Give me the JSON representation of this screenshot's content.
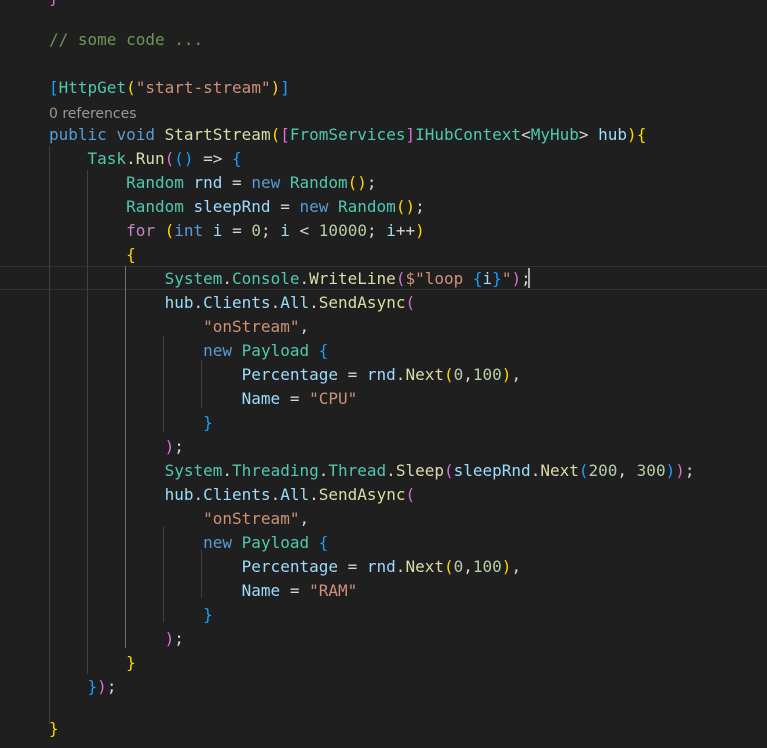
{
  "editor": {
    "codelens": "0 references",
    "lines": [
      [
        {
          "t": "}",
          "c": "b2"
        }
      ],
      [],
      [
        {
          "t": "// some code ...",
          "c": "cm"
        }
      ],
      [],
      [
        {
          "t": "[",
          "c": "b3"
        },
        {
          "t": "HttpGet",
          "c": "ty"
        },
        {
          "t": "(",
          "c": "b1"
        },
        {
          "t": "\"start-stream\"",
          "c": "st"
        },
        {
          "t": ")",
          "c": "b1"
        },
        {
          "t": "]",
          "c": "b3"
        }
      ],
      [
        {
          "t": "public",
          "c": "kw"
        },
        {
          "t": " ",
          "c": "tc"
        },
        {
          "t": "void",
          "c": "kw"
        },
        {
          "t": " ",
          "c": "tc"
        },
        {
          "t": "StartStream",
          "c": "fn"
        },
        {
          "t": "(",
          "c": "b1"
        },
        {
          "t": "[",
          "c": "b2"
        },
        {
          "t": "FromServices",
          "c": "ty"
        },
        {
          "t": "]",
          "c": "b2"
        },
        {
          "t": "IHubContext",
          "c": "ty"
        },
        {
          "t": "<",
          "c": "tc"
        },
        {
          "t": "MyHub",
          "c": "ty"
        },
        {
          "t": "> ",
          "c": "tc"
        },
        {
          "t": "hub",
          "c": "vr"
        },
        {
          "t": ")",
          "c": "b1"
        },
        {
          "t": "{",
          "c": "b1"
        }
      ],
      [
        {
          "t": "    ",
          "c": "tc"
        },
        {
          "t": "Task",
          "c": "ty"
        },
        {
          "t": ".",
          "c": "tc"
        },
        {
          "t": "Run",
          "c": "fn"
        },
        {
          "t": "(",
          "c": "b2"
        },
        {
          "t": "()",
          "c": "b3"
        },
        {
          "t": " => ",
          "c": "tc"
        },
        {
          "t": "{",
          "c": "b3"
        }
      ],
      [
        {
          "t": "        ",
          "c": "tc"
        },
        {
          "t": "Random",
          "c": "ty"
        },
        {
          "t": " ",
          "c": "tc"
        },
        {
          "t": "rnd",
          "c": "vr"
        },
        {
          "t": " = ",
          "c": "tc"
        },
        {
          "t": "new",
          "c": "kw"
        },
        {
          "t": " ",
          "c": "tc"
        },
        {
          "t": "Random",
          "c": "ty"
        },
        {
          "t": "()",
          "c": "b1"
        },
        {
          "t": ";",
          "c": "tc"
        }
      ],
      [
        {
          "t": "        ",
          "c": "tc"
        },
        {
          "t": "Random",
          "c": "ty"
        },
        {
          "t": " ",
          "c": "tc"
        },
        {
          "t": "sleepRnd",
          "c": "vr"
        },
        {
          "t": " = ",
          "c": "tc"
        },
        {
          "t": "new",
          "c": "kw"
        },
        {
          "t": " ",
          "c": "tc"
        },
        {
          "t": "Random",
          "c": "ty"
        },
        {
          "t": "()",
          "c": "b1"
        },
        {
          "t": ";",
          "c": "tc"
        }
      ],
      [
        {
          "t": "        ",
          "c": "tc"
        },
        {
          "t": "for",
          "c": "ctl"
        },
        {
          "t": " ",
          "c": "tc"
        },
        {
          "t": "(",
          "c": "b1"
        },
        {
          "t": "int",
          "c": "kw"
        },
        {
          "t": " ",
          "c": "tc"
        },
        {
          "t": "i",
          "c": "vr"
        },
        {
          "t": " = ",
          "c": "tc"
        },
        {
          "t": "0",
          "c": "nm"
        },
        {
          "t": "; ",
          "c": "tc"
        },
        {
          "t": "i",
          "c": "vr"
        },
        {
          "t": " < ",
          "c": "tc"
        },
        {
          "t": "10000",
          "c": "nm"
        },
        {
          "t": "; ",
          "c": "tc"
        },
        {
          "t": "i",
          "c": "vr"
        },
        {
          "t": "++",
          "c": "tc"
        },
        {
          "t": ")",
          "c": "b1"
        }
      ],
      [
        {
          "t": "        ",
          "c": "tc"
        },
        {
          "t": "{",
          "c": "b1"
        }
      ],
      [
        {
          "t": "            ",
          "c": "tc"
        },
        {
          "t": "System",
          "c": "ty"
        },
        {
          "t": ".",
          "c": "tc"
        },
        {
          "t": "Console",
          "c": "ty"
        },
        {
          "t": ".",
          "c": "tc"
        },
        {
          "t": "WriteLine",
          "c": "fn"
        },
        {
          "t": "(",
          "c": "b2"
        },
        {
          "t": "$\"loop ",
          "c": "st"
        },
        {
          "t": "{",
          "c": "b3"
        },
        {
          "t": "i",
          "c": "vr"
        },
        {
          "t": "}",
          "c": "b3"
        },
        {
          "t": "\"",
          "c": "st"
        },
        {
          "t": ")",
          "c": "b2"
        },
        {
          "t": ";",
          "c": "tc"
        }
      ],
      [
        {
          "t": "            ",
          "c": "tc"
        },
        {
          "t": "hub",
          "c": "vr"
        },
        {
          "t": ".",
          "c": "tc"
        },
        {
          "t": "Clients",
          "c": "vr"
        },
        {
          "t": ".",
          "c": "tc"
        },
        {
          "t": "All",
          "c": "vr"
        },
        {
          "t": ".",
          "c": "tc"
        },
        {
          "t": "SendAsync",
          "c": "fn"
        },
        {
          "t": "(",
          "c": "b2"
        }
      ],
      [
        {
          "t": "                ",
          "c": "tc"
        },
        {
          "t": "\"onStream\"",
          "c": "st"
        },
        {
          "t": ",",
          "c": "tc"
        }
      ],
      [
        {
          "t": "                ",
          "c": "tc"
        },
        {
          "t": "new",
          "c": "kw"
        },
        {
          "t": " ",
          "c": "tc"
        },
        {
          "t": "Payload",
          "c": "ty"
        },
        {
          "t": " ",
          "c": "tc"
        },
        {
          "t": "{",
          "c": "b3"
        }
      ],
      [
        {
          "t": "                    ",
          "c": "tc"
        },
        {
          "t": "Percentage",
          "c": "vr"
        },
        {
          "t": " = ",
          "c": "tc"
        },
        {
          "t": "rnd",
          "c": "vr"
        },
        {
          "t": ".",
          "c": "tc"
        },
        {
          "t": "Next",
          "c": "fn"
        },
        {
          "t": "(",
          "c": "b1"
        },
        {
          "t": "0",
          "c": "nm"
        },
        {
          "t": ",",
          "c": "tc"
        },
        {
          "t": "100",
          "c": "nm"
        },
        {
          "t": ")",
          "c": "b1"
        },
        {
          "t": ",",
          "c": "tc"
        }
      ],
      [
        {
          "t": "                    ",
          "c": "tc"
        },
        {
          "t": "Name",
          "c": "vr"
        },
        {
          "t": " = ",
          "c": "tc"
        },
        {
          "t": "\"CPU\"",
          "c": "st"
        }
      ],
      [
        {
          "t": "                ",
          "c": "tc"
        },
        {
          "t": "}",
          "c": "b3"
        }
      ],
      [
        {
          "t": "            ",
          "c": "tc"
        },
        {
          "t": ")",
          "c": "b2"
        },
        {
          "t": ";",
          "c": "tc"
        }
      ],
      [
        {
          "t": "            ",
          "c": "tc"
        },
        {
          "t": "System",
          "c": "ty"
        },
        {
          "t": ".",
          "c": "tc"
        },
        {
          "t": "Threading",
          "c": "ty"
        },
        {
          "t": ".",
          "c": "tc"
        },
        {
          "t": "Thread",
          "c": "ty"
        },
        {
          "t": ".",
          "c": "tc"
        },
        {
          "t": "Sleep",
          "c": "fn"
        },
        {
          "t": "(",
          "c": "b2"
        },
        {
          "t": "sleepRnd",
          "c": "vr"
        },
        {
          "t": ".",
          "c": "tc"
        },
        {
          "t": "Next",
          "c": "fn"
        },
        {
          "t": "(",
          "c": "b3"
        },
        {
          "t": "200",
          "c": "nm"
        },
        {
          "t": ", ",
          "c": "tc"
        },
        {
          "t": "300",
          "c": "nm"
        },
        {
          "t": ")",
          "c": "b3"
        },
        {
          "t": ")",
          "c": "b2"
        },
        {
          "t": ";",
          "c": "tc"
        }
      ],
      [
        {
          "t": "            ",
          "c": "tc"
        },
        {
          "t": "hub",
          "c": "vr"
        },
        {
          "t": ".",
          "c": "tc"
        },
        {
          "t": "Clients",
          "c": "vr"
        },
        {
          "t": ".",
          "c": "tc"
        },
        {
          "t": "All",
          "c": "vr"
        },
        {
          "t": ".",
          "c": "tc"
        },
        {
          "t": "SendAsync",
          "c": "fn"
        },
        {
          "t": "(",
          "c": "b2"
        }
      ],
      [
        {
          "t": "                ",
          "c": "tc"
        },
        {
          "t": "\"onStream\"",
          "c": "st"
        },
        {
          "t": ",",
          "c": "tc"
        }
      ],
      [
        {
          "t": "                ",
          "c": "tc"
        },
        {
          "t": "new",
          "c": "kw"
        },
        {
          "t": " ",
          "c": "tc"
        },
        {
          "t": "Payload",
          "c": "ty"
        },
        {
          "t": " ",
          "c": "tc"
        },
        {
          "t": "{",
          "c": "b3"
        }
      ],
      [
        {
          "t": "                    ",
          "c": "tc"
        },
        {
          "t": "Percentage",
          "c": "vr"
        },
        {
          "t": " = ",
          "c": "tc"
        },
        {
          "t": "rnd",
          "c": "vr"
        },
        {
          "t": ".",
          "c": "tc"
        },
        {
          "t": "Next",
          "c": "fn"
        },
        {
          "t": "(",
          "c": "b1"
        },
        {
          "t": "0",
          "c": "nm"
        },
        {
          "t": ",",
          "c": "tc"
        },
        {
          "t": "100",
          "c": "nm"
        },
        {
          "t": ")",
          "c": "b1"
        },
        {
          "t": ",",
          "c": "tc"
        }
      ],
      [
        {
          "t": "                    ",
          "c": "tc"
        },
        {
          "t": "Name",
          "c": "vr"
        },
        {
          "t": " = ",
          "c": "tc"
        },
        {
          "t": "\"RAM\"",
          "c": "st"
        }
      ],
      [
        {
          "t": "                ",
          "c": "tc"
        },
        {
          "t": "}",
          "c": "b3"
        }
      ],
      [
        {
          "t": "            ",
          "c": "tc"
        },
        {
          "t": ")",
          "c": "b2"
        },
        {
          "t": ";",
          "c": "tc"
        }
      ],
      [
        {
          "t": "        ",
          "c": "tc"
        },
        {
          "t": "}",
          "c": "b1"
        }
      ],
      [
        {
          "t": "    ",
          "c": "tc"
        },
        {
          "t": "}",
          "c": "b3"
        },
        {
          "t": ")",
          "c": "b2"
        },
        {
          "t": ";",
          "c": "tc"
        }
      ],
      [],
      [
        {
          "t": "}",
          "c": "b1"
        }
      ]
    ]
  }
}
